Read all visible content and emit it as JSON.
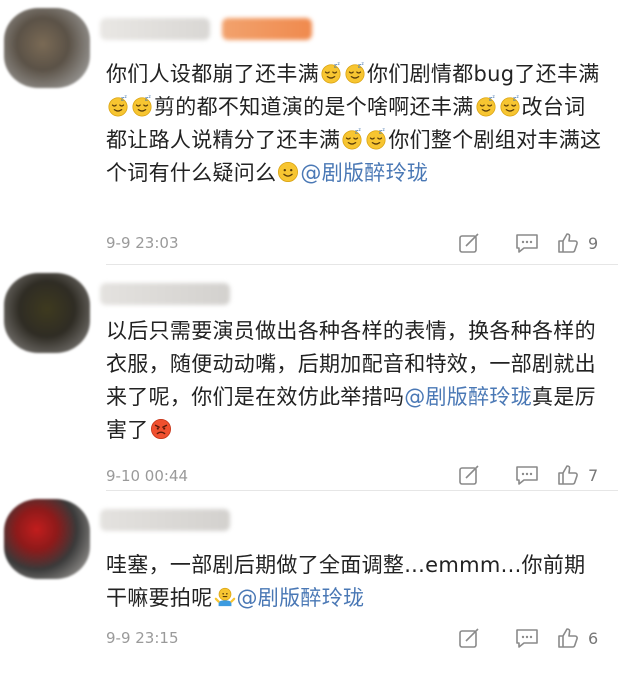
{
  "comments": [
    {
      "parts": [
        {
          "t": "text",
          "v": "你们人设都崩了还丰满"
        },
        {
          "t": "emoji",
          "icon": "sleepy-face-icon"
        },
        {
          "t": "emoji",
          "icon": "sleepy-face-icon"
        },
        {
          "t": "text",
          "v": "你们剧情都bug了还丰满"
        },
        {
          "t": "emoji",
          "icon": "sleepy-face-icon"
        },
        {
          "t": "emoji",
          "icon": "sleepy-face-icon"
        },
        {
          "t": "text",
          "v": "剪的都不知道演的是个啥啊还丰满"
        },
        {
          "t": "emoji",
          "icon": "sleepy-face-icon"
        },
        {
          "t": "emoji",
          "icon": "sleepy-face-icon"
        },
        {
          "t": "text",
          "v": "改台词都让路人说精分了还丰满"
        },
        {
          "t": "emoji",
          "icon": "sleepy-face-icon"
        },
        {
          "t": "emoji",
          "icon": "sleepy-face-icon"
        },
        {
          "t": "text",
          "v": "你们整个剧组对丰满这个词有什么疑问么"
        },
        {
          "t": "emoji",
          "icon": "smile-face-icon"
        },
        {
          "t": "link",
          "v": "@剧版醉玲珑"
        }
      ],
      "time": "9-9 23:03",
      "likes": "9"
    },
    {
      "parts": [
        {
          "t": "text",
          "v": "以后只需要演员做出各种各样的表情，换各种各样的衣服，随便动动嘴，后期加配音和特效，一部剧就出来了呢，你们是在效仿此举措吗"
        },
        {
          "t": "link",
          "v": "@剧版醉玲珑"
        },
        {
          "t": "text",
          "v": "真是厉害了"
        },
        {
          "t": "emoji",
          "icon": "angry-face-icon"
        }
      ],
      "time": "9-10 00:44",
      "likes": "7"
    },
    {
      "parts": [
        {
          "t": "text",
          "v": "哇塞，一部剧后期做了全面调整...emmm...你前期干嘛要拍呢"
        },
        {
          "t": "emoji",
          "icon": "shrug-icon"
        },
        {
          "t": "link",
          "v": "@剧版醉玲珑"
        }
      ],
      "time": "9-9 23:15",
      "likes": "6"
    }
  ],
  "colors": {
    "link": "#4a78b5",
    "meta": "#9a9a9a",
    "text": "#222222"
  }
}
